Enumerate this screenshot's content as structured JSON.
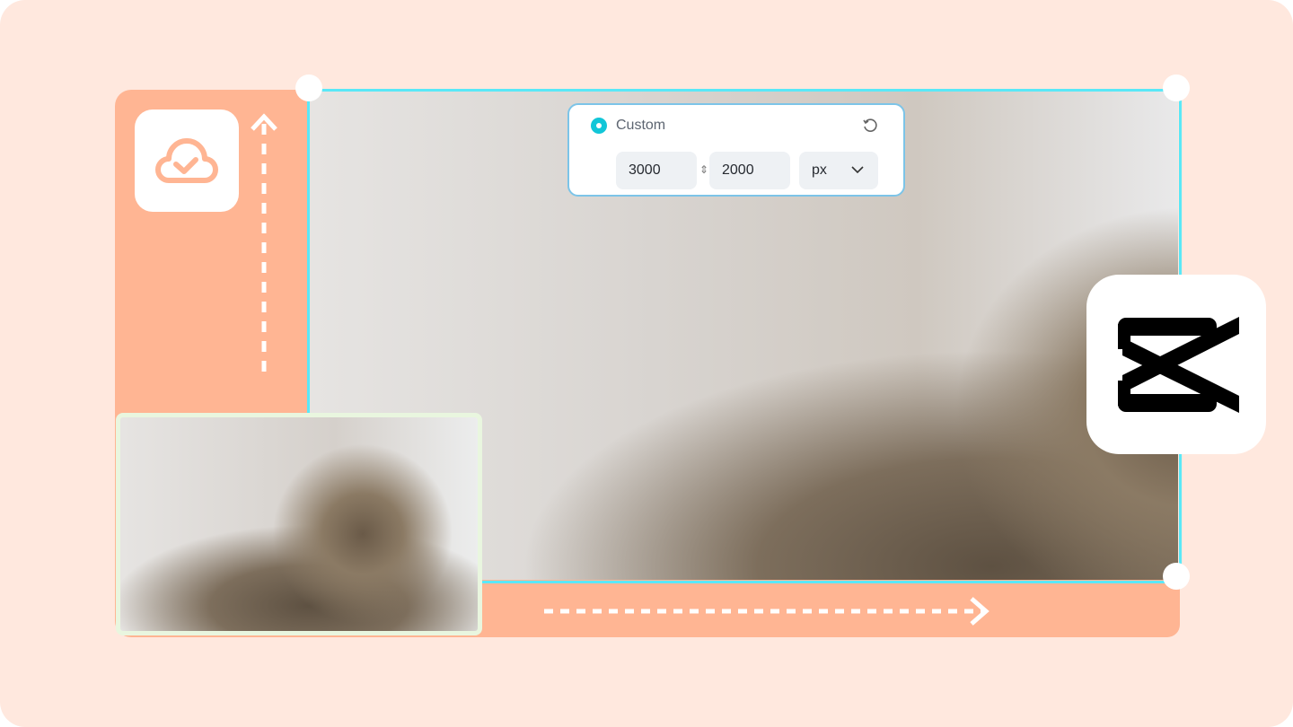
{
  "size_panel": {
    "option_label": "Custom",
    "width_value": "3000",
    "height_value": "2000",
    "unit": "px",
    "icons": {
      "radio": "radio-selected-icon",
      "reset": "reset-icon",
      "link": "aspect-link-icon",
      "dropdown": "chevron-down-icon"
    }
  },
  "icons": {
    "cloud": "cloud-check-icon",
    "brand": "capcut-logo",
    "up_arrow": "dashed-arrow-up-icon",
    "right_arrow": "dashed-arrow-right-icon"
  },
  "colors": {
    "background": "#ffe8de",
    "accent_orange": "#ffb593",
    "frame_cyan": "#5ae8f7",
    "radio": "#12c6d8"
  }
}
